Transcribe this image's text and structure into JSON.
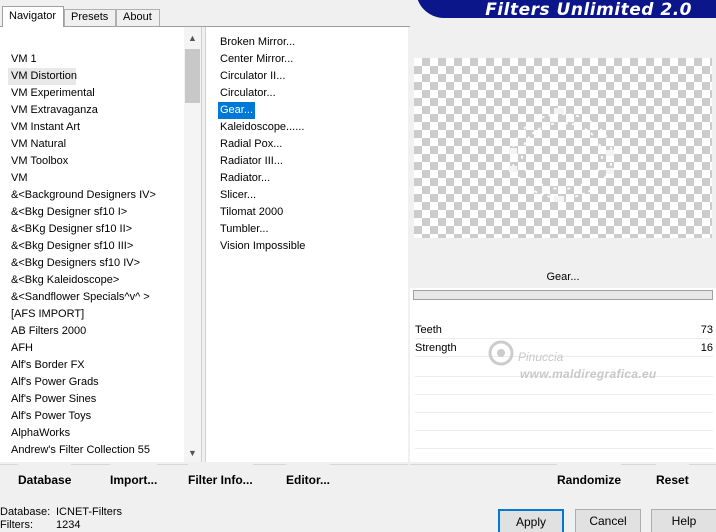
{
  "tabs": [
    {
      "label": "Navigator"
    },
    {
      "label": "Presets"
    },
    {
      "label": "About"
    }
  ],
  "app": {
    "title": "Filters Unlimited 2.0"
  },
  "categories": [
    "VM 1",
    "VM Distortion",
    "VM Experimental",
    "VM Extravaganza",
    "VM Instant Art",
    "VM Natural",
    "VM Toolbox",
    "VM",
    "&<Background Designers IV>",
    "&<Bkg Designer sf10 I>",
    "&<BKg Designer sf10 II>",
    "&<Bkg Designer sf10 III>",
    "&<Bkg Designers sf10 IV>",
    "&<Bkg Kaleidoscope>",
    "&<Sandflower Specials^v^ >",
    "[AFS IMPORT]",
    "AB Filters 2000",
    "AFH",
    "Alf's Border FX",
    "Alf's Power Grads",
    "Alf's Power Sines",
    "Alf's Power Toys",
    "AlphaWorks",
    "Andrew's Filter Collection 55"
  ],
  "filters": [
    "Broken Mirror...",
    "Center Mirror...",
    "Circulator II...",
    "Circulator...",
    "Gear...",
    "Kaleidoscope......",
    "Radial Pox...",
    "Radiator III...",
    "Radiator...",
    "Slicer...",
    "Tilomat 2000",
    "Tumbler...",
    "Vision Impossible"
  ],
  "selected_filter": "Gear...",
  "params": [
    {
      "label": "Teeth",
      "value": "73"
    },
    {
      "label": "Strength",
      "value": "16"
    }
  ],
  "watermark": {
    "name": "Pinuccia",
    "url": "www.maldiregrafica.eu"
  },
  "toolbar": {
    "database": "Database",
    "import": "Import...",
    "filter_info": "Filter Info...",
    "editor": "Editor...",
    "randomize": "Randomize",
    "reset": "Reset"
  },
  "status": {
    "database_label": "Database:",
    "database_value": "ICNET-Filters",
    "filters_label": "Filters:",
    "filters_value": "1234"
  },
  "buttons": {
    "apply": "Apply",
    "cancel": "Cancel",
    "help": "Help"
  },
  "colors": {
    "banner": "#0b168a",
    "selection": "#0078d7"
  }
}
